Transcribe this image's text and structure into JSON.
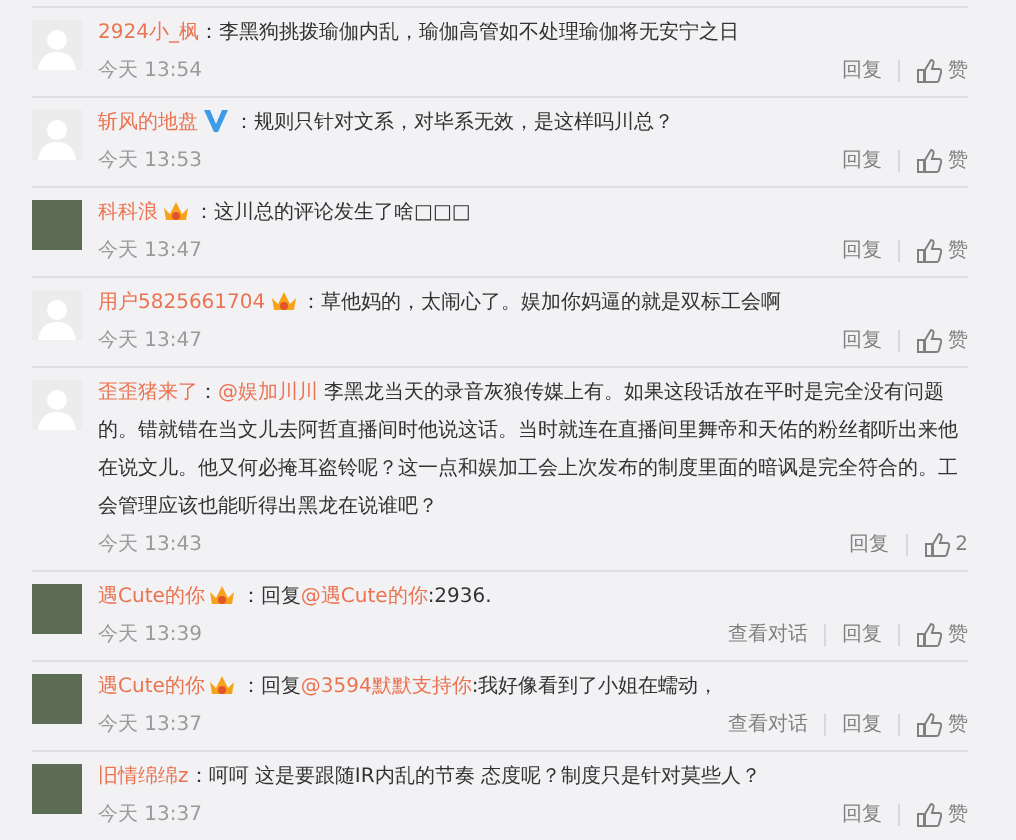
{
  "comments": [
    {
      "avatar": {
        "kind": "default"
      },
      "user": "2924小_枫",
      "segments": [
        {
          "kind": "text",
          "text": "：李黑狗挑拨瑜伽内乱，瑜伽高管如不处理瑜伽将无安宁之日"
        }
      ],
      "time": "今天 13:54",
      "actions": [
        "回复"
      ],
      "like": "赞"
    },
    {
      "avatar": {
        "kind": "default"
      },
      "user": "斩风的地盘",
      "badge": {
        "kind": "verified"
      },
      "segments": [
        {
          "kind": "text",
          "text": "：规则只针对文系，对毕系无效，是这样吗川总？"
        }
      ],
      "time": "今天 13:53",
      "actions": [
        "回复"
      ],
      "like": "赞"
    },
    {
      "avatar": {
        "kind": "photo"
      },
      "user": "科科浪",
      "badge": {
        "kind": "vip"
      },
      "segments": [
        {
          "kind": "text",
          "text": "：这川总的评论发生了啥□□□"
        }
      ],
      "time": "今天 13:47",
      "actions": [
        "回复"
      ],
      "like": "赞"
    },
    {
      "avatar": {
        "kind": "default"
      },
      "user": "用户5825661704",
      "badge": {
        "kind": "vip"
      },
      "segments": [
        {
          "kind": "text",
          "text": "：草他妈的，太闹心了。娱加你妈逼的就是双标工会啊"
        }
      ],
      "time": "今天 13:47",
      "actions": [
        "回复"
      ],
      "like": "赞"
    },
    {
      "avatar": {
        "kind": "default"
      },
      "user": "歪歪猪来了",
      "segments": [
        {
          "kind": "text",
          "text": "："
        },
        {
          "kind": "mention",
          "text": "@娱加川川"
        },
        {
          "kind": "text",
          "text": " 李黑龙当天的录音灰狼传媒上有。如果这段话放在平时是完全没有问题的。错就错在当文儿去阿哲直播间时他说这话。当时就连在直播间里舞帝和天佑的粉丝都听出来他在说文儿。他又何必掩耳盗铃呢？这一点和娱加工会上次发布的制度里面的暗讽是完全符合的。工会管理应该也能听得出黑龙在说谁吧？"
        }
      ],
      "time": "今天 13:43",
      "actions": [
        "回复"
      ],
      "like": "2"
    },
    {
      "avatar": {
        "kind": "photo"
      },
      "user": "遇Cute的你",
      "badge": {
        "kind": "vip"
      },
      "segments": [
        {
          "kind": "text",
          "text": "：回复"
        },
        {
          "kind": "mention",
          "text": "@遇Cute的你"
        },
        {
          "kind": "text",
          "text": ":2936."
        }
      ],
      "time": "今天 13:39",
      "actions": [
        "查看对话",
        "回复"
      ],
      "like": "赞"
    },
    {
      "avatar": {
        "kind": "photo"
      },
      "user": "遇Cute的你",
      "badge": {
        "kind": "vip"
      },
      "segments": [
        {
          "kind": "text",
          "text": "：回复"
        },
        {
          "kind": "mention",
          "text": "@3594默默支持你"
        },
        {
          "kind": "text",
          "text": ":我好像看到了小姐在蠕动，"
        }
      ],
      "time": "今天 13:37",
      "actions": [
        "查看对话",
        "回复"
      ],
      "like": "赞"
    },
    {
      "avatar": {
        "kind": "photo"
      },
      "user": "旧情绵绵z",
      "segments": [
        {
          "kind": "text",
          "text": "：呵呵 这是要跟随IR内乱的节奏 态度呢？制度只是针对莫些人？"
        }
      ],
      "time": "今天 13:37",
      "actions": [
        "回复"
      ],
      "like": "赞"
    }
  ]
}
